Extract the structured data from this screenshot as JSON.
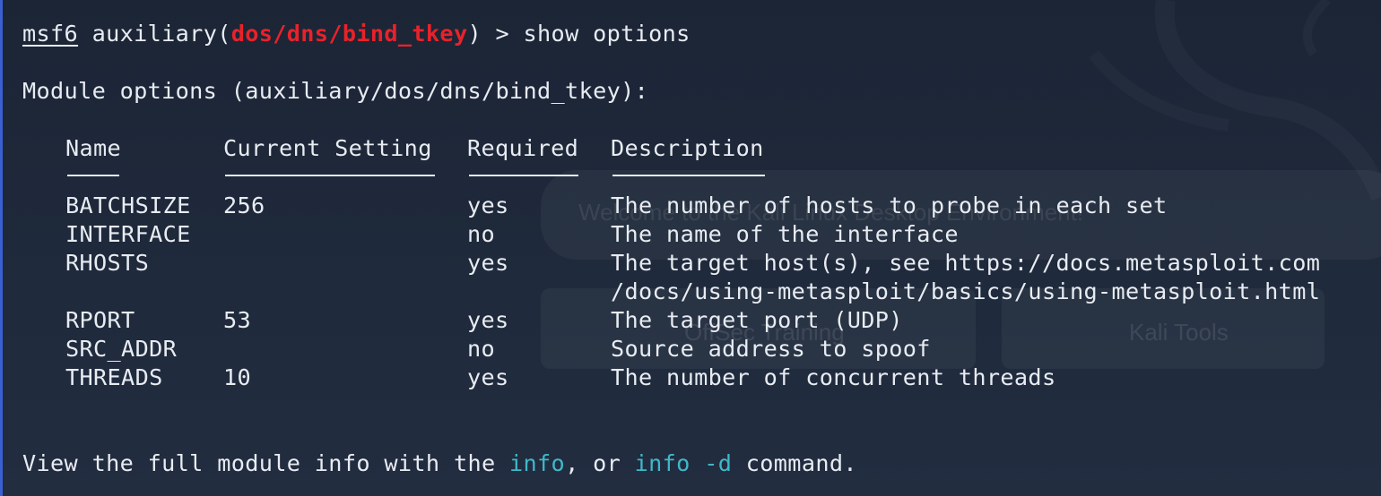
{
  "prompt": {
    "msf": "msf6",
    "module_prefix": " auxiliary(",
    "module_name": "dos/dns/bind_tkey",
    "module_suffix": ") > ",
    "command": "show options"
  },
  "heading": "Module options (auxiliary/dos/dns/bind_tkey):",
  "table": {
    "columns": [
      "Name",
      "Current Setting",
      "Required",
      "Description"
    ],
    "rows": [
      {
        "name": "BATCHSIZE",
        "setting": "256",
        "required": "yes",
        "description": "The number of hosts to probe in each set",
        "description2": ""
      },
      {
        "name": "INTERFACE",
        "setting": "",
        "required": "no",
        "description": "The name of the interface",
        "description2": ""
      },
      {
        "name": "RHOSTS",
        "setting": "",
        "required": "yes",
        "description": "The target host(s), see https://docs.metasploit.com",
        "description2": "/docs/using-metasploit/basics/using-metasploit.html"
      },
      {
        "name": "RPORT",
        "setting": "53",
        "required": "yes",
        "description": "The target port (UDP)",
        "description2": ""
      },
      {
        "name": "SRC_ADDR",
        "setting": "",
        "required": "no",
        "description": "Source address to spoof",
        "description2": ""
      },
      {
        "name": "THREADS",
        "setting": "10",
        "required": "yes",
        "description": "The number of concurrent threads",
        "description2": ""
      }
    ]
  },
  "footer": {
    "pre": "View the full module info with the ",
    "cmd1": "info",
    "mid": ", or ",
    "cmd2": "info -d",
    "post": " command."
  },
  "background": {
    "welcome_text": "Welcome to the Kali Linux Desktop Environment!",
    "button_left": "OffSec Training",
    "button_right": "Kali Tools"
  },
  "colors": {
    "terminal_bg": "#1e2738",
    "text": "#e8ecf2",
    "module_red": "#e8222a",
    "command_cyan": "#3fb8c8"
  }
}
